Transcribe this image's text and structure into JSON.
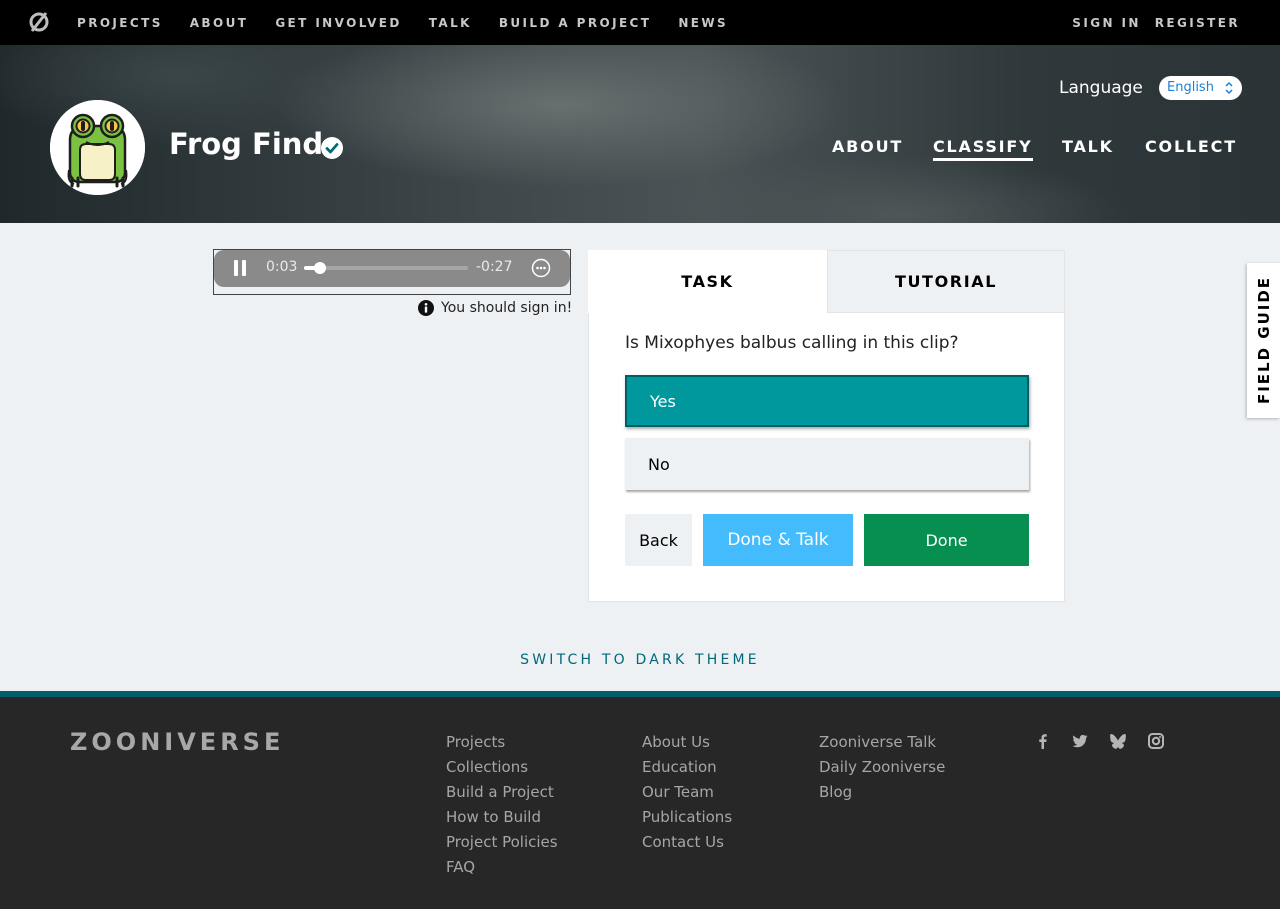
{
  "topnav": {
    "links": [
      "PROJECTS",
      "ABOUT",
      "GET INVOLVED",
      "TALK",
      "BUILD A PROJECT",
      "NEWS"
    ],
    "sign_in": "SIGN IN",
    "register": "REGISTER"
  },
  "project": {
    "title": "Frog Find",
    "language_label": "Language",
    "language_value": "English",
    "tabs": [
      "ABOUT",
      "CLASSIFY",
      "TALK",
      "COLLECT"
    ],
    "active_tab": "CLASSIFY"
  },
  "player": {
    "elapsed": "0:03",
    "remaining": "-0:27",
    "progress": 0.1
  },
  "signin_note": "You should sign in!",
  "task": {
    "tab_task": "TASK",
    "tab_tutorial": "TUTORIAL",
    "question": "Is Mixophyes balbus calling in this clip?",
    "answers": [
      "Yes",
      "No"
    ],
    "selected_answer": "Yes",
    "back_label": "Back",
    "done_talk_label": "Done & Talk",
    "done_label": "Done"
  },
  "field_guide": "FIELD GUIDE",
  "dark_theme_label": "SWITCH TO DARK THEME",
  "footer": {
    "logo": "ZOONIVERSE",
    "col1": [
      "Projects",
      "Collections",
      "Build a Project",
      "How to Build",
      "Project Policies",
      "FAQ"
    ],
    "col2": [
      "About Us",
      "Education",
      "Our Team",
      "Publications",
      "Contact Us"
    ],
    "col3": [
      "Zooniverse Talk",
      "Daily Zooniverse",
      "Blog"
    ],
    "social_icons": [
      "facebook-icon",
      "twitter-icon",
      "bluesky-icon",
      "instagram-icon"
    ]
  },
  "colors": {
    "accent_teal": "#00979d",
    "done_green": "#078f52",
    "done_talk_blue": "#43bbfd",
    "footer_bg": "#272727"
  }
}
